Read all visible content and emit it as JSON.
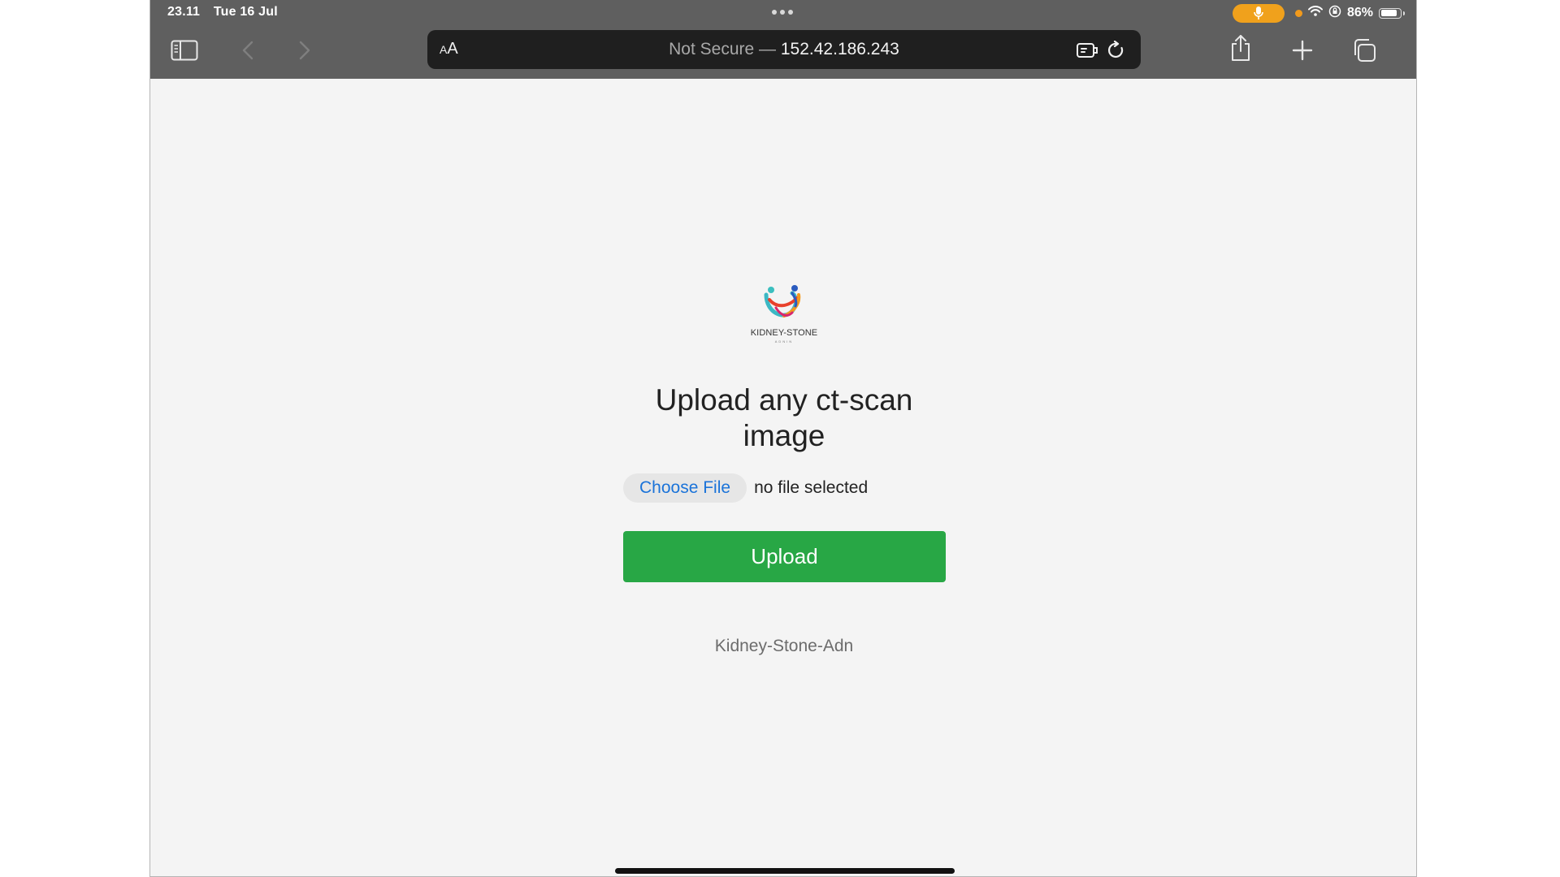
{
  "status_bar": {
    "time": "23.11",
    "date": "Tue 16 Jul",
    "battery_percent": "86%",
    "battery_level": 0.86,
    "icons": [
      "microphone-icon",
      "orange-dot-indicator",
      "wifi-icon",
      "orientation-lock-icon",
      "battery-icon"
    ],
    "accent": "#f0a11c"
  },
  "toolbar": {
    "icons": [
      "sidebar-icon",
      "back-icon",
      "forward-icon",
      "share-icon",
      "new-tab-icon",
      "tabs-icon"
    ]
  },
  "address_bar": {
    "reader_label_small": "A",
    "reader_label_large": "A",
    "security_label": "Not Secure —",
    "host": "152.42.186.243",
    "icons": [
      "page-extension-icon",
      "reload-icon"
    ]
  },
  "page": {
    "logo_text": "KIDNEY-STONE",
    "logo_subtext": "ADNIN",
    "heading": "Upload any ct-scan image",
    "choose_file_label": "Choose File",
    "file_status": "no file selected",
    "upload_label": "Upload",
    "upload_color": "#28a745",
    "footer": "Kidney-Stone-Adn"
  }
}
